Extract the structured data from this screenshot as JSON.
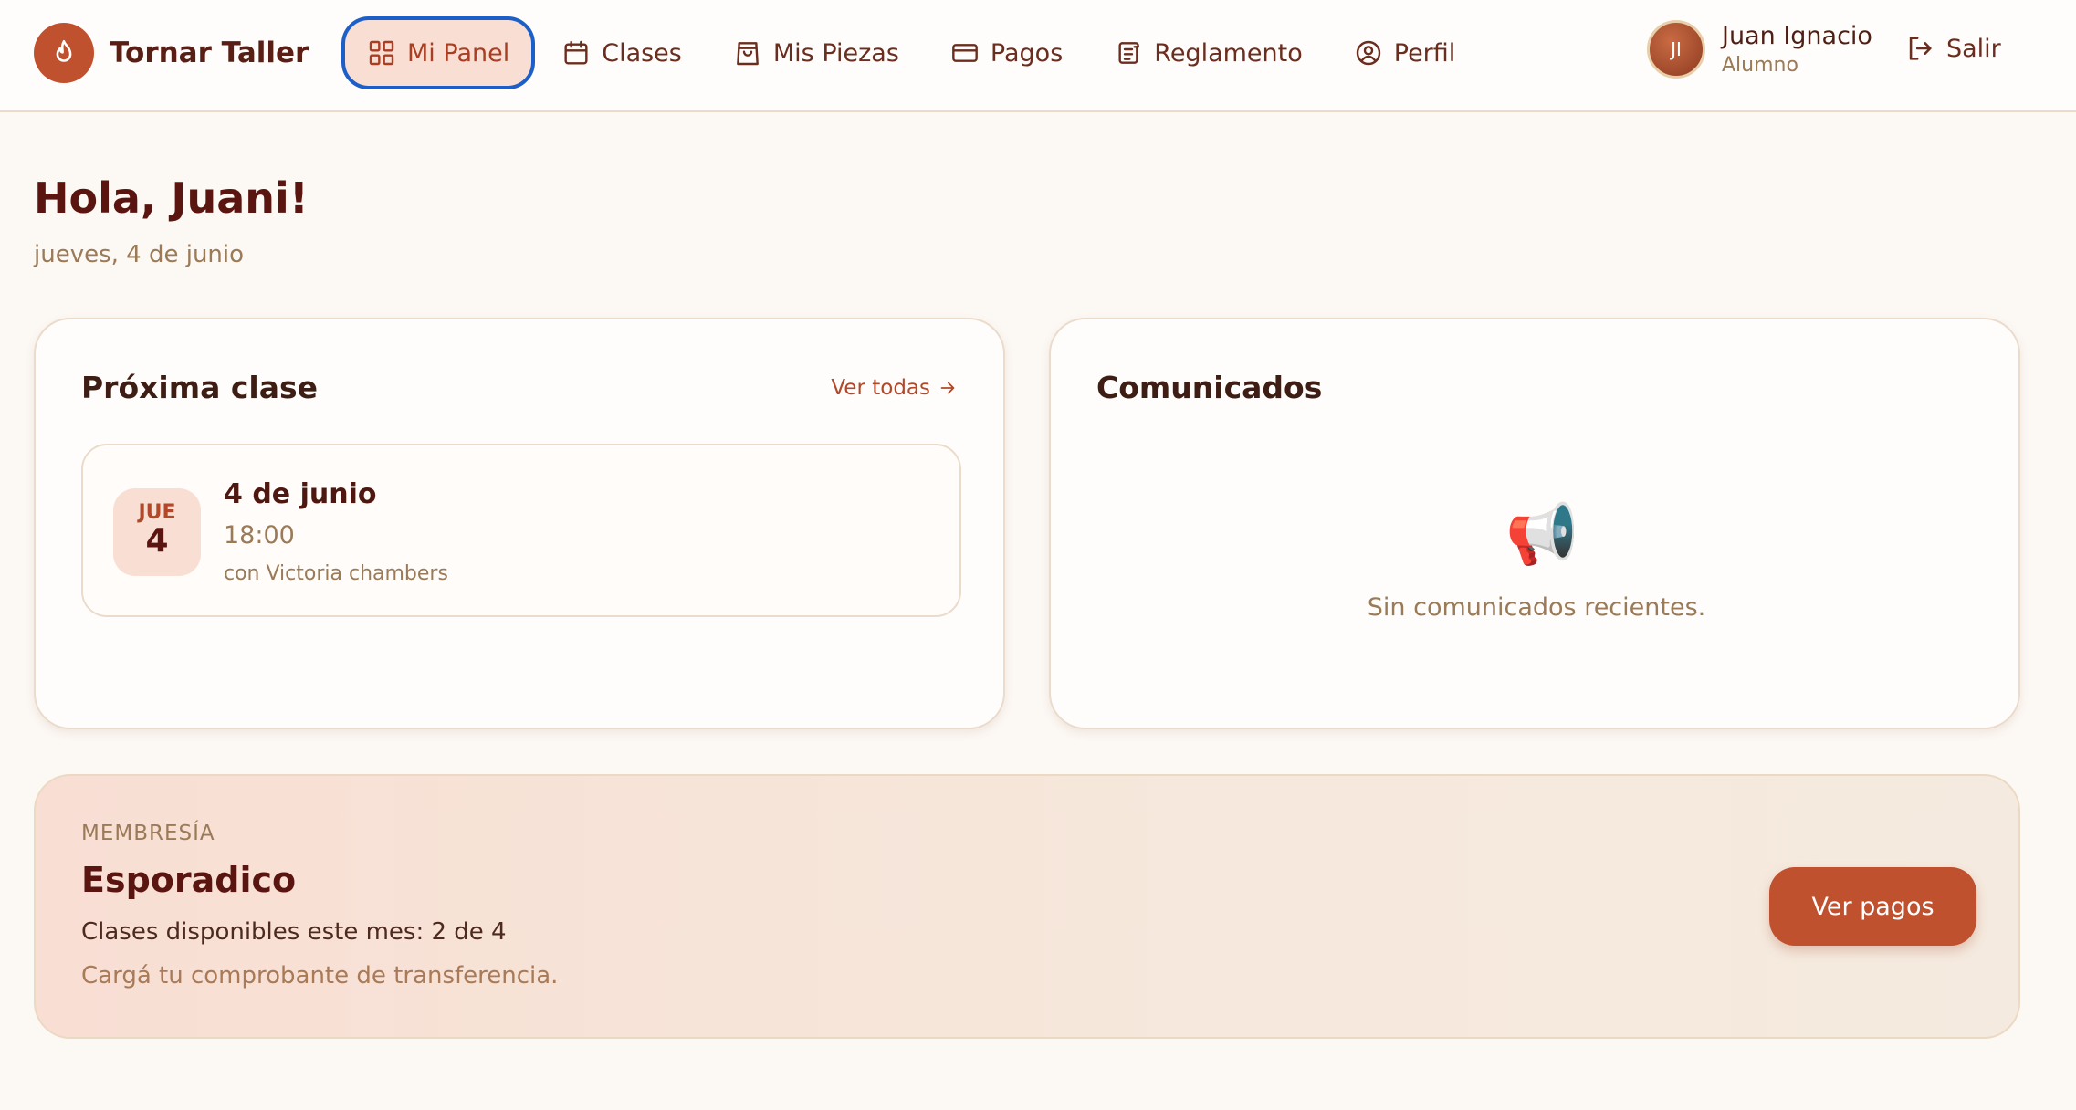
{
  "brand": {
    "name": "Tornar Taller",
    "icon": "flame-icon"
  },
  "nav": {
    "items": [
      {
        "label": "Mi Panel",
        "icon": "grid-icon",
        "active": true
      },
      {
        "label": "Clases",
        "icon": "calendar-icon"
      },
      {
        "label": "Mis Piezas",
        "icon": "bag-icon"
      },
      {
        "label": "Pagos",
        "icon": "credit-card-icon"
      },
      {
        "label": "Reglamento",
        "icon": "scroll-icon"
      },
      {
        "label": "Perfil",
        "icon": "user-circle-icon"
      }
    ]
  },
  "user": {
    "initials": "JI",
    "name": "Juan Ignacio",
    "role": "Alumno"
  },
  "logout": {
    "label": "Salir",
    "icon": "logout-icon"
  },
  "header": {
    "greeting": "Hola, Juani!",
    "date": "jueves, 4 de junio"
  },
  "next_class": {
    "title": "Próxima clase",
    "see_all": "Ver todas",
    "day_abbr": "JUE",
    "day_num": "4",
    "date": "4 de junio",
    "time": "18:00",
    "teacher": "con Victoria chambers"
  },
  "announcements": {
    "title": "Comunicados",
    "empty_icon": "📢",
    "empty_text": "Sin comunicados recientes."
  },
  "membership": {
    "label": "MEMBRESÍA",
    "name": "Esporadico",
    "classes": "Clases disponibles este mes: 2 de 4",
    "note": "Cargá tu comprobante de transferencia.",
    "button": "Ver pagos"
  },
  "colors": {
    "accent": "#c0512f",
    "active_border": "#1d5fc8",
    "active_bg": "#f9ded4"
  }
}
